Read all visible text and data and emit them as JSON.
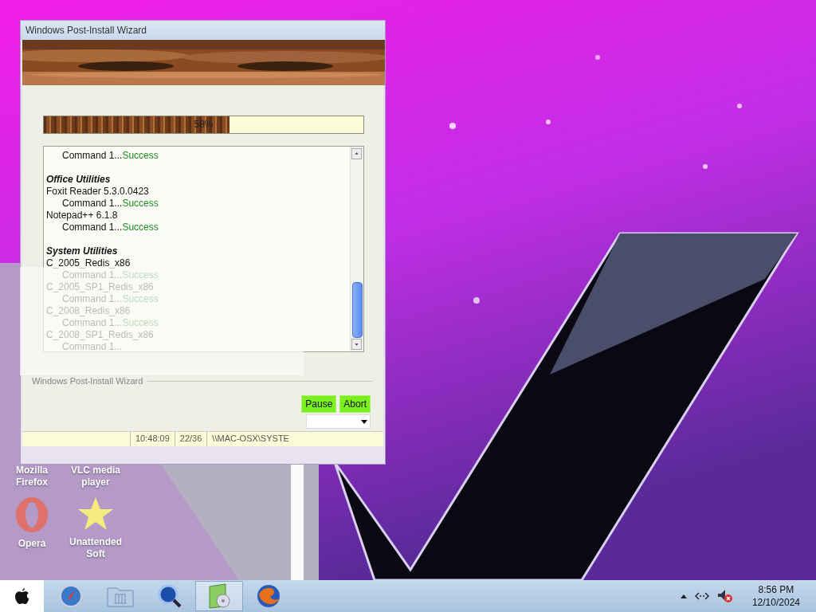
{
  "window": {
    "title": "Windows Post-Install Wizard",
    "banner": {
      "kind": "picture"
    },
    "progress": {
      "level": 0.58,
      "label": "58%"
    },
    "log": [
      {
        "kind": "command",
        "text": "Command 1...",
        "status": "Success"
      },
      {
        "kind": "header",
        "text": "Office Utilities"
      },
      {
        "kind": "item",
        "text": "Foxit Reader 5.3.0.0423"
      },
      {
        "kind": "command",
        "text": "Command 1...",
        "status": "Success"
      },
      {
        "kind": "item",
        "text": "Notepad++ 6.1.8"
      },
      {
        "kind": "command",
        "text": "Command 1...",
        "status": "Success"
      },
      {
        "kind": "header",
        "text": "System Utilities"
      },
      {
        "kind": "item",
        "text": "C_2005_Redis_x86"
      },
      {
        "kind": "command",
        "text": "Command 1...",
        "status": "Success"
      },
      {
        "kind": "item",
        "text": "C_2005_SP1_Redis_x86"
      },
      {
        "kind": "command",
        "text": "Command 1...",
        "status": "Success"
      },
      {
        "kind": "item",
        "text": "C_2008_Redis_x86"
      },
      {
        "kind": "command",
        "text": "Command 1...",
        "status": "Success"
      },
      {
        "kind": "item",
        "text": "C_2008_SP1_Redis_x86"
      },
      {
        "kind": "command",
        "text": "Command 1..."
      }
    ],
    "group_label": "Windows Post-Install Wizard",
    "buttons": [
      "Pause",
      "Abort"
    ],
    "status_bar": [
      "10:48:09",
      "22/36",
      "\\\\MAC-OSX\\SYSTE"
    ]
  },
  "desktop_icons": [
    {
      "kind": "label-only",
      "label": "Mozilla Firefox"
    },
    {
      "kind": "label-only",
      "label": "VLC media player"
    },
    {
      "kind": "opera",
      "label": "Opera"
    },
    {
      "kind": "star",
      "label": "Unattended Soft"
    }
  ],
  "taskbar": {
    "apps": [
      {
        "kind": "compass",
        "selected": false
      },
      {
        "kind": "folder",
        "selected": false
      },
      {
        "kind": "magnifier",
        "selected": false
      },
      {
        "kind": "disc",
        "selected": true
      },
      {
        "kind": "fox",
        "selected": false
      }
    ],
    "clock": {
      "time": "8:56 PM",
      "date": "12/10/2024"
    }
  }
}
